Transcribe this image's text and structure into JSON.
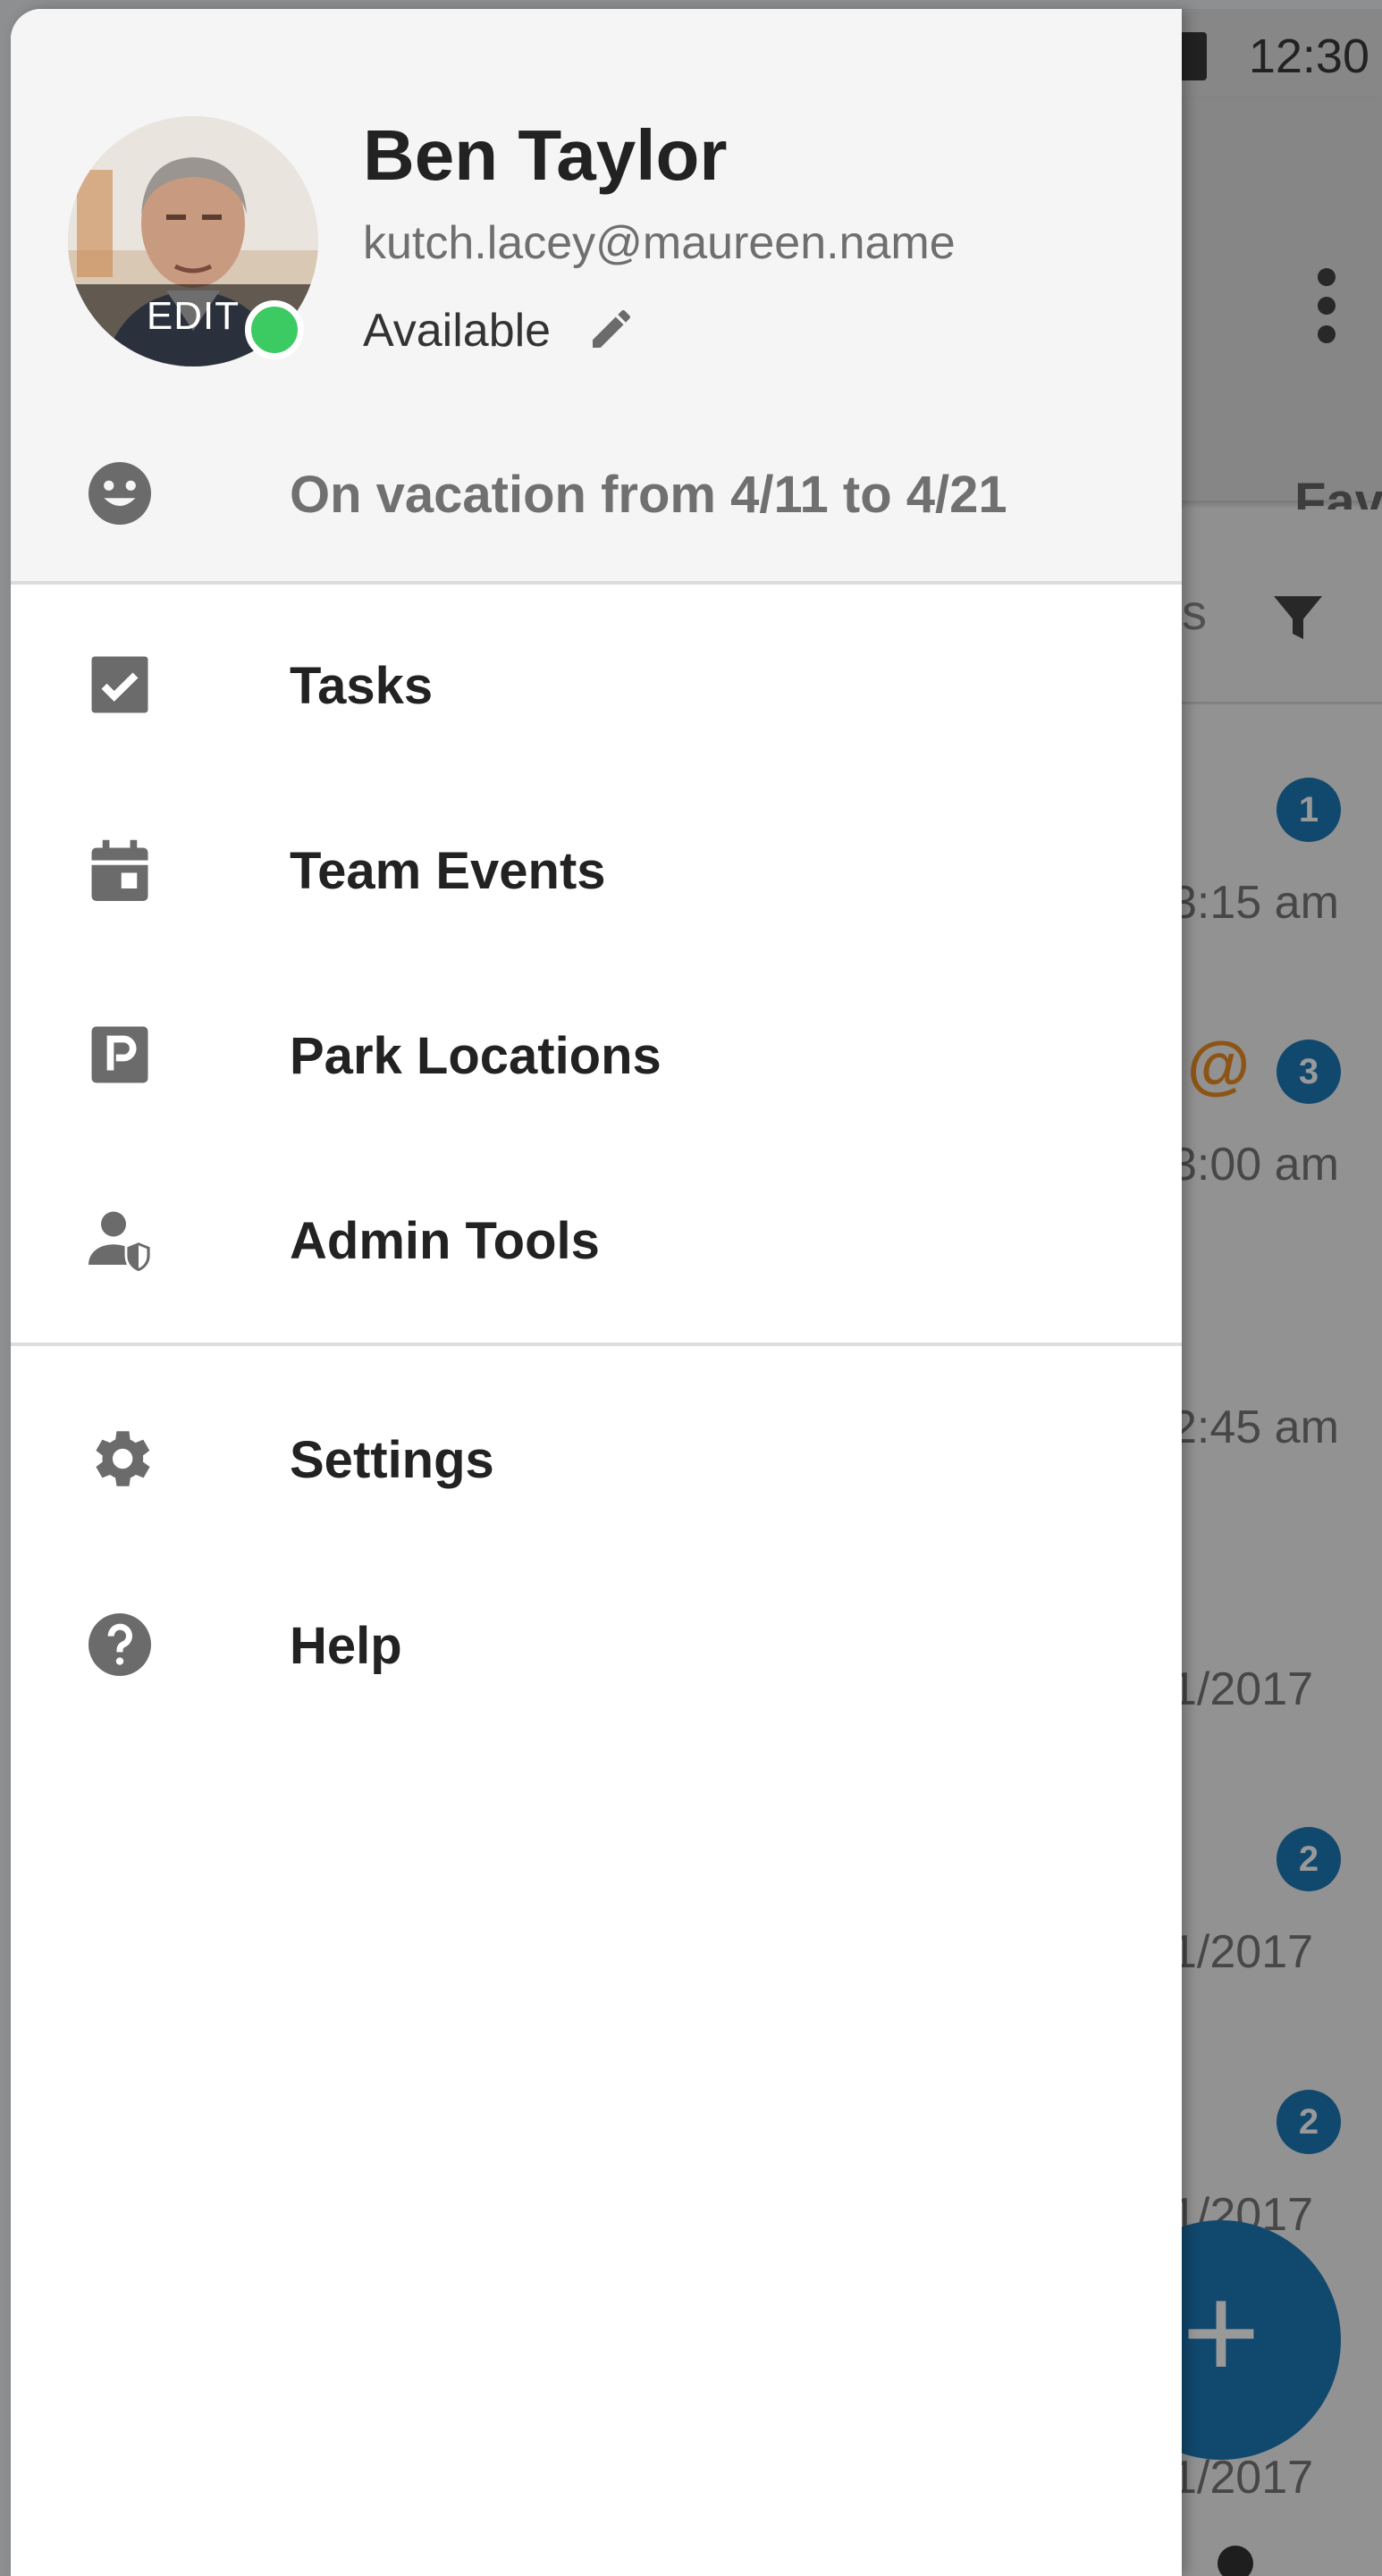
{
  "status_bar": {
    "time": "12:30"
  },
  "background": {
    "tab_partial": "Fav",
    "filter_partial": "s",
    "rows": [
      {
        "time": "3:15 am",
        "badge": "1",
        "at": ""
      },
      {
        "time": "3:00 am",
        "badge": "3",
        "at": "@"
      },
      {
        "time": "2:45 am",
        "badge": "",
        "at": ""
      },
      {
        "time": "1/2017",
        "badge": "",
        "at": ""
      },
      {
        "time": "1/2017",
        "badge": "2",
        "at": ""
      },
      {
        "time": "1/2017",
        "badge": "2",
        "at": ""
      },
      {
        "time": "1/2017",
        "badge": "",
        "at": ""
      }
    ],
    "fab_label": "+"
  },
  "drawer": {
    "profile": {
      "name": "Ben Taylor",
      "email": "kutch.lacey@maureen.name",
      "status": "Available",
      "avatar_edit_label": "EDIT",
      "presence_color": "#3ccb63"
    },
    "custom_status": {
      "icon": "smiley-icon",
      "text": "On vacation from 4/11 to 4/21"
    },
    "items": [
      {
        "label": "Tasks",
        "icon": "checkbox-icon"
      },
      {
        "label": "Team Events",
        "icon": "calendar-icon"
      },
      {
        "label": "Park Locations",
        "icon": "parking-icon"
      },
      {
        "label": "Admin Tools",
        "icon": "admin-shield-icon"
      }
    ],
    "secondary_items": [
      {
        "label": "Settings",
        "icon": "gear-icon"
      },
      {
        "label": "Help",
        "icon": "help-icon"
      }
    ]
  },
  "colors": {
    "accent": "#1d78b7",
    "mention": "#ec8e24",
    "icon_gray": "#6b6b6b"
  }
}
